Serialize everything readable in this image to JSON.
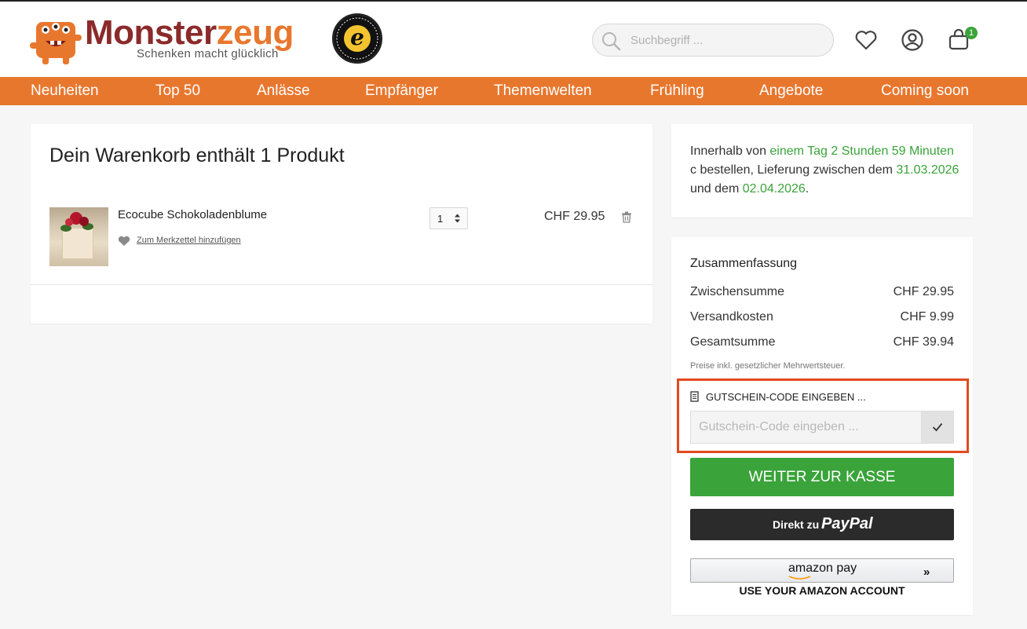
{
  "brand": {
    "name_part1": "Monster",
    "name_part2": "zeug",
    "tagline": "Schenken macht glücklich",
    "color_primary": "#8b2a2a",
    "color_accent": "#e8772e"
  },
  "header": {
    "search_placeholder": "Suchbegriff ...",
    "cart_count": "1",
    "icons": [
      "search-icon",
      "heart-icon",
      "account-icon",
      "cart-icon"
    ]
  },
  "nav": {
    "items": [
      "Neuheiten",
      "Top 50",
      "Anlässe",
      "Empfänger",
      "Themenwelten",
      "Frühling",
      "Angebote",
      "Coming soon"
    ]
  },
  "cart": {
    "title": "Dein Warenkorb enthält 1 Produkt",
    "items": [
      {
        "name": "Ecocube Schokoladenblume",
        "wishlist_label": "Zum Merkzettel hinzufügen",
        "quantity": "1",
        "price": "CHF 29.95"
      }
    ]
  },
  "delivery": {
    "prefix": "Innerhalb von ",
    "time": "einem Tag 2 Stunden 59 Minuten",
    "middle": "c bestellen, Lieferung zwischen dem",
    "date_from": "31.03.2026",
    "and": " und dem ",
    "date_to": "02.04.2026",
    "suffix": "."
  },
  "summary": {
    "title": "Zusammenfassung",
    "rows": [
      {
        "label": "Zwischensumme",
        "value": "CHF 29.95"
      },
      {
        "label": "Versandkosten",
        "value": "CHF 9.99"
      },
      {
        "label": "Gesamtsumme",
        "value": "CHF 39.94"
      }
    ],
    "tax_note": "Preise inkl. gesetzlicher Mehrwertsteuer.",
    "coupon_heading": "GUTSCHEIN-CODE EINGEBEN ...",
    "coupon_placeholder": "Gutschein-Code eingeben ...",
    "checkout_label": "WEITER ZUR KASSE",
    "paypal_prefix": "Direkt zu",
    "paypal_brand": "PayPal",
    "amazon_label": "amazon pay",
    "amazon_sub": "USE YOUR AMAZON ACCOUNT",
    "colors": {
      "checkout": "#3aa33a",
      "highlight": "#e24a1f"
    }
  }
}
